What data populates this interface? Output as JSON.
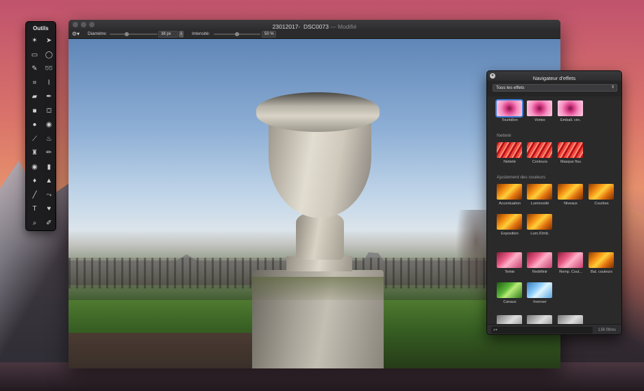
{
  "tools_palette": {
    "title": "Outils",
    "tools": [
      {
        "icon": "magic-wand-icon",
        "glyph": "✶"
      },
      {
        "icon": "arrow-pointer-icon",
        "glyph": "➤"
      },
      {
        "icon": "rect-select-icon",
        "glyph": "▭"
      },
      {
        "icon": "ellipse-select-icon",
        "glyph": "◯"
      },
      {
        "icon": "marker-icon",
        "glyph": "✎"
      },
      {
        "icon": "lasso-icon",
        "glyph": "➿"
      },
      {
        "icon": "crop-icon",
        "glyph": "⌗"
      },
      {
        "icon": "eyedropper-icon",
        "glyph": "⌇"
      },
      {
        "icon": "eraser-icon",
        "glyph": "▰"
      },
      {
        "icon": "pen-icon",
        "glyph": "✒"
      },
      {
        "icon": "shape-icon",
        "glyph": "■"
      },
      {
        "icon": "paint-bucket-icon",
        "glyph": "⛋"
      },
      {
        "icon": "lemon-icon",
        "glyph": "●"
      },
      {
        "icon": "lollipop-icon",
        "glyph": "◉"
      },
      {
        "icon": "brush-icon",
        "glyph": "⟋"
      },
      {
        "icon": "flame-icon",
        "glyph": "♨"
      },
      {
        "icon": "stamp-icon",
        "glyph": "♜"
      },
      {
        "icon": "pencil-icon",
        "glyph": "✏"
      },
      {
        "icon": "eye-icon",
        "glyph": "◉"
      },
      {
        "icon": "smudge-icon",
        "glyph": "▮"
      },
      {
        "icon": "drop-icon",
        "glyph": "♦"
      },
      {
        "icon": "cone-icon",
        "glyph": "▲"
      },
      {
        "icon": "line-icon",
        "glyph": "╱"
      },
      {
        "icon": "blur-icon",
        "glyph": "⤳"
      },
      {
        "icon": "text-icon",
        "glyph": "T"
      },
      {
        "icon": "heart-icon",
        "glyph": "♥"
      },
      {
        "icon": "zoom-icon",
        "glyph": "⌕"
      },
      {
        "icon": "color-picker-icon",
        "glyph": "✐"
      }
    ]
  },
  "window": {
    "title": "23012017-_DSC0073",
    "title_status": " — Modifié",
    "toolbar": {
      "diameter_label": "Diamètre:",
      "diameter_value": "38 px",
      "diameter_level": 0.35,
      "intensity_label": "Intensité:",
      "intensity_value": "50 %",
      "intensity_level": 0.5
    }
  },
  "effects_panel": {
    "title": "Navigateur d'effets",
    "filter_select": "Tous les effets",
    "search_placeholder": "",
    "count": "136 filtres",
    "rows": [
      {
        "section": "",
        "items": [
          {
            "label": "Tourbillon",
            "style": "pink-flower",
            "selected": true
          },
          {
            "label": "Vortex",
            "style": "pink-flower",
            "selected": false
          },
          {
            "label": "Emball. circ.",
            "style": "pink-flower",
            "selected": false
          }
        ]
      },
      {
        "section": "Netteté",
        "items": [
          {
            "label": "Netteté",
            "style": "red-fx",
            "selected": false
          },
          {
            "label": "Contours",
            "style": "red-fx",
            "selected": false
          },
          {
            "label": "Masque flou",
            "style": "red-fx",
            "selected": false
          }
        ]
      },
      {
        "section": "Ajustement des couleurs",
        "items": [
          {
            "label": "Accentuation",
            "style": "orange-fx",
            "selected": false
          },
          {
            "label": "Luminosité",
            "style": "orange-fx",
            "selected": false
          },
          {
            "label": "Niveaux",
            "style": "orange-fx",
            "selected": false
          },
          {
            "label": "Courbes",
            "style": "orange-fx",
            "selected": false
          }
        ]
      },
      {
        "section": "",
        "items": [
          {
            "label": "Exposition",
            "style": "orange-fx",
            "selected": false
          },
          {
            "label": "Lum./Omb.",
            "style": "orange-fx",
            "selected": false
          }
        ]
      },
      {
        "section": "",
        "items": [
          {
            "label": "Teinte",
            "style": "pink-fx",
            "selected": false
          },
          {
            "label": "Redéfinir",
            "style": "pink-fx",
            "selected": false
          },
          {
            "label": "Remp. Coul...",
            "style": "pink-fx",
            "selected": false
          },
          {
            "label": "Bal. couleurs",
            "style": "orange-fx",
            "selected": false
          }
        ]
      },
      {
        "section": "",
        "items": [
          {
            "label": "Canaux",
            "style": "green-fx",
            "selected": false
          },
          {
            "label": "Inverser",
            "style": "cyan-fx",
            "selected": false
          }
        ]
      }
    ]
  },
  "colors": {
    "accent_selection": "#3a7bd5",
    "panel_background": "#252526"
  }
}
